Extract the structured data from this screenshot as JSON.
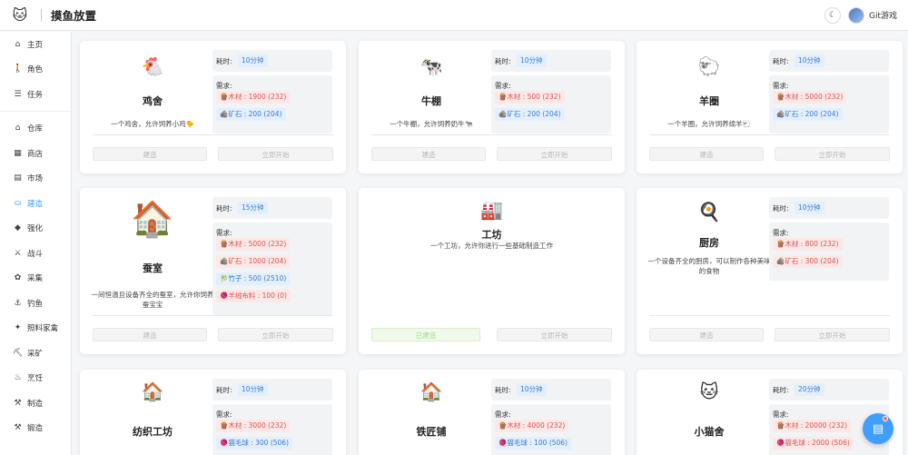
{
  "header": {
    "title": "摸鱼放置",
    "logo_icon": "cat-logo-icon",
    "theme_icon": "moon-icon",
    "user_name": "Git游戏"
  },
  "sidebar": {
    "items": [
      {
        "label": "主页",
        "icon": "home-icon",
        "glyph": "⌂"
      },
      {
        "label": "角色",
        "icon": "person-walk-icon",
        "glyph": "🚶"
      },
      {
        "label": "任务",
        "icon": "list-icon",
        "glyph": "☰"
      },
      {
        "label": "仓库",
        "icon": "warehouse-icon",
        "glyph": "⌂"
      },
      {
        "label": "商店",
        "icon": "shop-icon",
        "glyph": "▦"
      },
      {
        "label": "市场",
        "icon": "market-icon",
        "glyph": "▤"
      },
      {
        "label": "建造",
        "icon": "build-icon",
        "glyph": "⛀",
        "active": true
      },
      {
        "label": "强化",
        "icon": "enhance-icon",
        "glyph": "◆"
      },
      {
        "label": "战斗",
        "icon": "sword-icon",
        "glyph": "⚔"
      },
      {
        "label": "采集",
        "icon": "gather-icon",
        "glyph": "✿"
      },
      {
        "label": "钓鱼",
        "icon": "fishing-icon",
        "glyph": "⚓"
      },
      {
        "label": "照料家禽",
        "icon": "poultry-icon",
        "glyph": "✦"
      },
      {
        "label": "采矿",
        "icon": "pickaxe-icon",
        "glyph": "⛏"
      },
      {
        "label": "烹饪",
        "icon": "cook-icon",
        "glyph": "♨"
      },
      {
        "label": "制造",
        "icon": "hammer-icon",
        "glyph": "⚒"
      },
      {
        "label": "锻造",
        "icon": "forge-icon",
        "glyph": "⚒"
      }
    ]
  },
  "labels": {
    "time": "耗时:",
    "needs": "需求:",
    "build": "建造",
    "start": "立即开始",
    "built": "已建造"
  },
  "buildings": [
    {
      "name": "鸡舍",
      "emoji": "🐔",
      "desc": "一个鸡舍，允许饲养小鸡🐤",
      "time": "10分钟",
      "needs": [
        {
          "text": "🪵木材 : 1900 (232)",
          "style": "red"
        },
        {
          "text": "🪨矿石 : 200 (204)",
          "style": "blue"
        }
      ]
    },
    {
      "name": "牛棚",
      "emoji": "🐄",
      "desc": "一个牛棚，允许饲养奶牛🐄",
      "time": "10分钟",
      "needs": [
        {
          "text": "🪵木材 : 500 (232)",
          "style": "red"
        },
        {
          "text": "🪨矿石 : 200 (204)",
          "style": "blue"
        }
      ]
    },
    {
      "name": "羊圈",
      "emoji": "🐑",
      "desc": "一个羊圈，允许饲养绵羊🐑",
      "time": "10分钟",
      "needs": [
        {
          "text": "🪵木材 : 5000 (232)",
          "style": "red"
        },
        {
          "text": "🪨矿石 : 200 (204)",
          "style": "blue"
        }
      ]
    },
    {
      "name": "蚕室",
      "emoji": "🏠",
      "desc": "一间恒温且设备齐全的蚕室，允许你饲养蚕宝宝",
      "time": "15分钟",
      "needs": [
        {
          "text": "🪵木材 : 5000 (232)",
          "style": "red"
        },
        {
          "text": "🪨矿石 : 1000 (204)",
          "style": "red"
        },
        {
          "text": "🎋竹子 : 500 (2510)",
          "style": "blue"
        },
        {
          "text": "🧶羊绒布料 : 100 (0)",
          "style": "red"
        }
      ]
    },
    {
      "name": "工坊",
      "emoji": "🏭",
      "desc": "一个工坊，允许你进行一些基础制造工作",
      "built": true
    },
    {
      "name": "厨房",
      "emoji": "🍳",
      "desc": "一个设备齐全的厨房，可以制作各种美味的食物",
      "time": "10分钟",
      "needs": [
        {
          "text": "🪵木材 : 800 (232)",
          "style": "red"
        },
        {
          "text": "🪨矿石 : 300 (204)",
          "style": "red"
        }
      ]
    },
    {
      "name": "纺织工坊",
      "emoji": "🏠",
      "time": "10分钟",
      "needs": [
        {
          "text": "🪵木材 : 3000 (232)",
          "style": "red"
        },
        {
          "text": "🧶猫毛球 : 300 (506)",
          "style": "blue"
        }
      ]
    },
    {
      "name": "铁匠铺",
      "emoji": "🏠",
      "time": "10分钟",
      "needs": [
        {
          "text": "🪵木材 : 4000 (232)",
          "style": "red"
        },
        {
          "text": "🧶猫毛球 : 100 (506)",
          "style": "blue"
        }
      ]
    },
    {
      "name": "小猫舍",
      "emoji": "🐱",
      "time": "20分钟",
      "needs": [
        {
          "text": "🪵木材 : 20000 (232)",
          "style": "red"
        },
        {
          "text": "🧶猫毛球 : 2000 (506)",
          "style": "red"
        }
      ]
    }
  ],
  "fab": {
    "icon": "chat-icon"
  }
}
